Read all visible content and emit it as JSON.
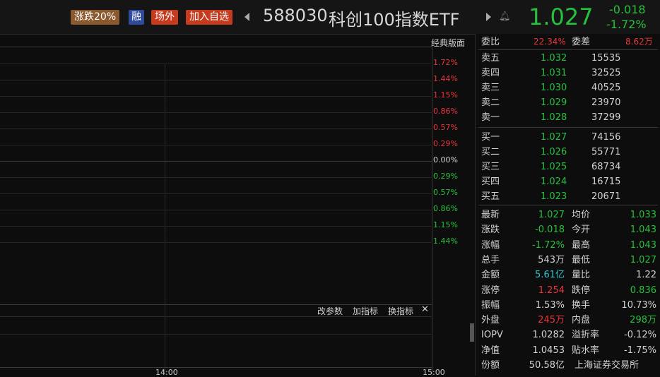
{
  "header": {
    "limit_tag": "涨跌20%",
    "margin_tag": "融",
    "offexchange_tag": "场外",
    "add_watchlist": "加入自选",
    "security_code": "588030",
    "security_name": "科创100指数ETF",
    "price": "1.027",
    "change": "-0.018",
    "change_pct": "-1.72%"
  },
  "chart": {
    "mode_label": "经典版面",
    "pct_ticks_up": [
      "1.72%",
      "1.44%",
      "1.15%",
      "0.86%",
      "0.57%",
      "0.29%"
    ],
    "pct_tick_zero": "0.00%",
    "pct_ticks_down": [
      "0.29%",
      "0.57%",
      "0.86%",
      "1.15%",
      "1.44%"
    ],
    "toolbar": {
      "edit_params": "改参数",
      "add_indicator": "加指标",
      "switch_indicator": "换指标",
      "close": "✕"
    },
    "time_labels": [
      "14:00",
      "15:00"
    ]
  },
  "panel": {
    "weibi_label": "委比",
    "weibi_value": "22.34%",
    "weicha_label": "委差",
    "weicha_value": "8.62万",
    "asks": [
      {
        "label": "卖五",
        "price": "1.032",
        "vol": "15535"
      },
      {
        "label": "卖四",
        "price": "1.031",
        "vol": "32525"
      },
      {
        "label": "卖三",
        "price": "1.030",
        "vol": "40525"
      },
      {
        "label": "卖二",
        "price": "1.029",
        "vol": "23970"
      },
      {
        "label": "卖一",
        "price": "1.028",
        "vol": "37299"
      }
    ],
    "bids": [
      {
        "label": "买一",
        "price": "1.027",
        "vol": "74156"
      },
      {
        "label": "买二",
        "price": "1.026",
        "vol": "55771"
      },
      {
        "label": "买三",
        "price": "1.025",
        "vol": "68734"
      },
      {
        "label": "买四",
        "price": "1.024",
        "vol": "16715"
      },
      {
        "label": "买五",
        "price": "1.023",
        "vol": "20671"
      }
    ],
    "stats": [
      {
        "l1": "最新",
        "v1": "1.027",
        "c1": "g",
        "l2": "均价",
        "v2": "1.033",
        "c2": "g"
      },
      {
        "l1": "涨跌",
        "v1": "-0.018",
        "c1": "g",
        "l2": "今开",
        "v2": "1.043",
        "c2": "g"
      },
      {
        "l1": "涨幅",
        "v1": "-1.72%",
        "c1": "g",
        "l2": "最高",
        "v2": "1.043",
        "c2": "g"
      },
      {
        "l1": "总手",
        "v1": "543万",
        "c1": "w",
        "l2": "最低",
        "v2": "1.027",
        "c2": "g"
      },
      {
        "l1": "金额",
        "v1": "5.61亿",
        "c1": "c",
        "l2": "量比",
        "v2": "1.22",
        "c2": "w"
      },
      {
        "l1": "涨停",
        "v1": "1.254",
        "c1": "r",
        "l2": "跌停",
        "v2": "0.836",
        "c2": "g"
      },
      {
        "l1": "振幅",
        "v1": "1.53%",
        "c1": "w",
        "l2": "换手",
        "v2": "10.73%",
        "c2": "w"
      },
      {
        "l1": "外盘",
        "v1": "245万",
        "c1": "r",
        "l2": "内盘",
        "v2": "298万",
        "c2": "g"
      },
      {
        "l1": "IOPV",
        "v1": "1.0282",
        "c1": "w",
        "l2": "溢折率",
        "v2": "-0.12%",
        "c2": "w"
      },
      {
        "l1": "净值",
        "v1": "1.0453",
        "c1": "w",
        "l2": "贴水率",
        "v2": "-1.75%",
        "c2": "w"
      },
      {
        "l1": "份额",
        "v1": "50.58亿",
        "c1": "w",
        "l2": "上海证券交易所",
        "v2": "",
        "c2": "w"
      }
    ]
  },
  "colors": {
    "up": "#e8353b",
    "down": "#27c03c",
    "accent": "#2ec8d0"
  }
}
